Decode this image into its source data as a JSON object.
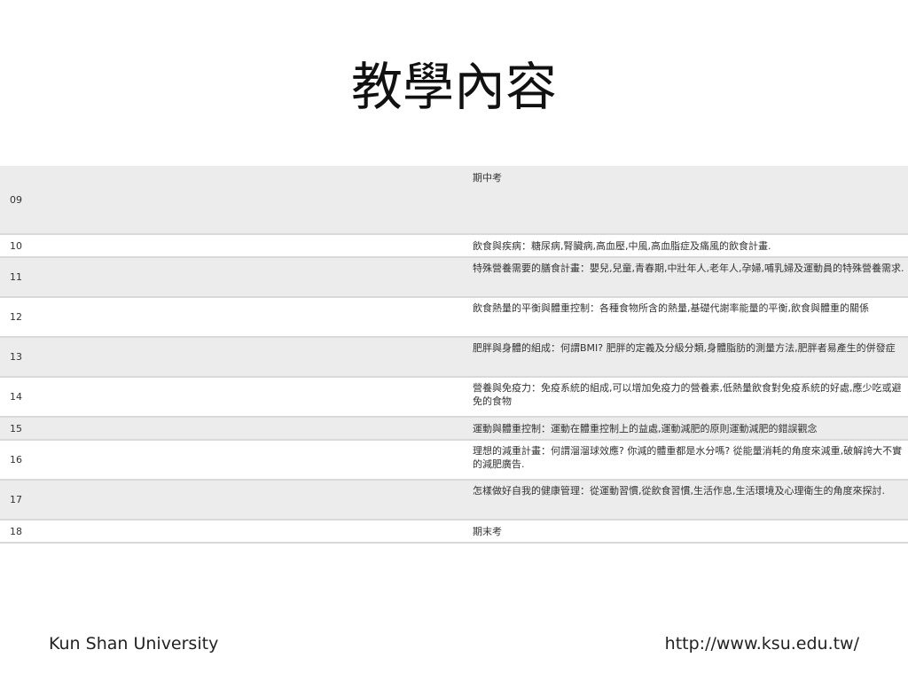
{
  "title": "教學內容",
  "schedule": {
    "rows": [
      {
        "week": "09",
        "content": "期中考"
      },
      {
        "week": "10",
        "content": "飲食與疾病：糖尿病,腎臟病,高血壓,中風,高血脂症及痛風的飲食計畫."
      },
      {
        "week": "11",
        "content": "特殊營養需要的膳食計畫：嬰兒,兒童,青春期,中壯年人,老年人,孕婦,哺乳婦及運動員的特殊營養需求."
      },
      {
        "week": "12",
        "content": "飲食熱量的平衡與體重控制：各種食物所含的熱量,基礎代謝率能量的平衡,飲食與體重的關係"
      },
      {
        "week": "13",
        "content": "肥胖與身體的組成：何謂BMI? 肥胖的定義及分級分類,身體脂肪的測量方法,肥胖者易產生的併發症"
      },
      {
        "week": "14",
        "content": "營養與免疫力：免疫系統的組成,可以增加免疫力的營養素,低熱量飲食對免疫系統的好處,應少吃或避免的食物"
      },
      {
        "week": "15",
        "content": "運動與體重控制：運動在體重控制上的益處,運動減肥的原則運動減肥的錯誤觀念"
      },
      {
        "week": "16",
        "content": "理想的減重計畫：何謂溜溜球效應? 你減的體重都是水分嗎? 從能量消耗的角度來減重,破解誇大不實的減肥廣告."
      },
      {
        "week": "17",
        "content": "怎樣做好自我的健康管理：從運動習慣,從飲食習慣,生活作息,生活環境及心理衛生的角度來探討."
      },
      {
        "week": "18",
        "content": "期末考"
      }
    ]
  },
  "footer": {
    "left": "Kun Shan University",
    "right": "http://www.ksu.edu.tw/"
  }
}
